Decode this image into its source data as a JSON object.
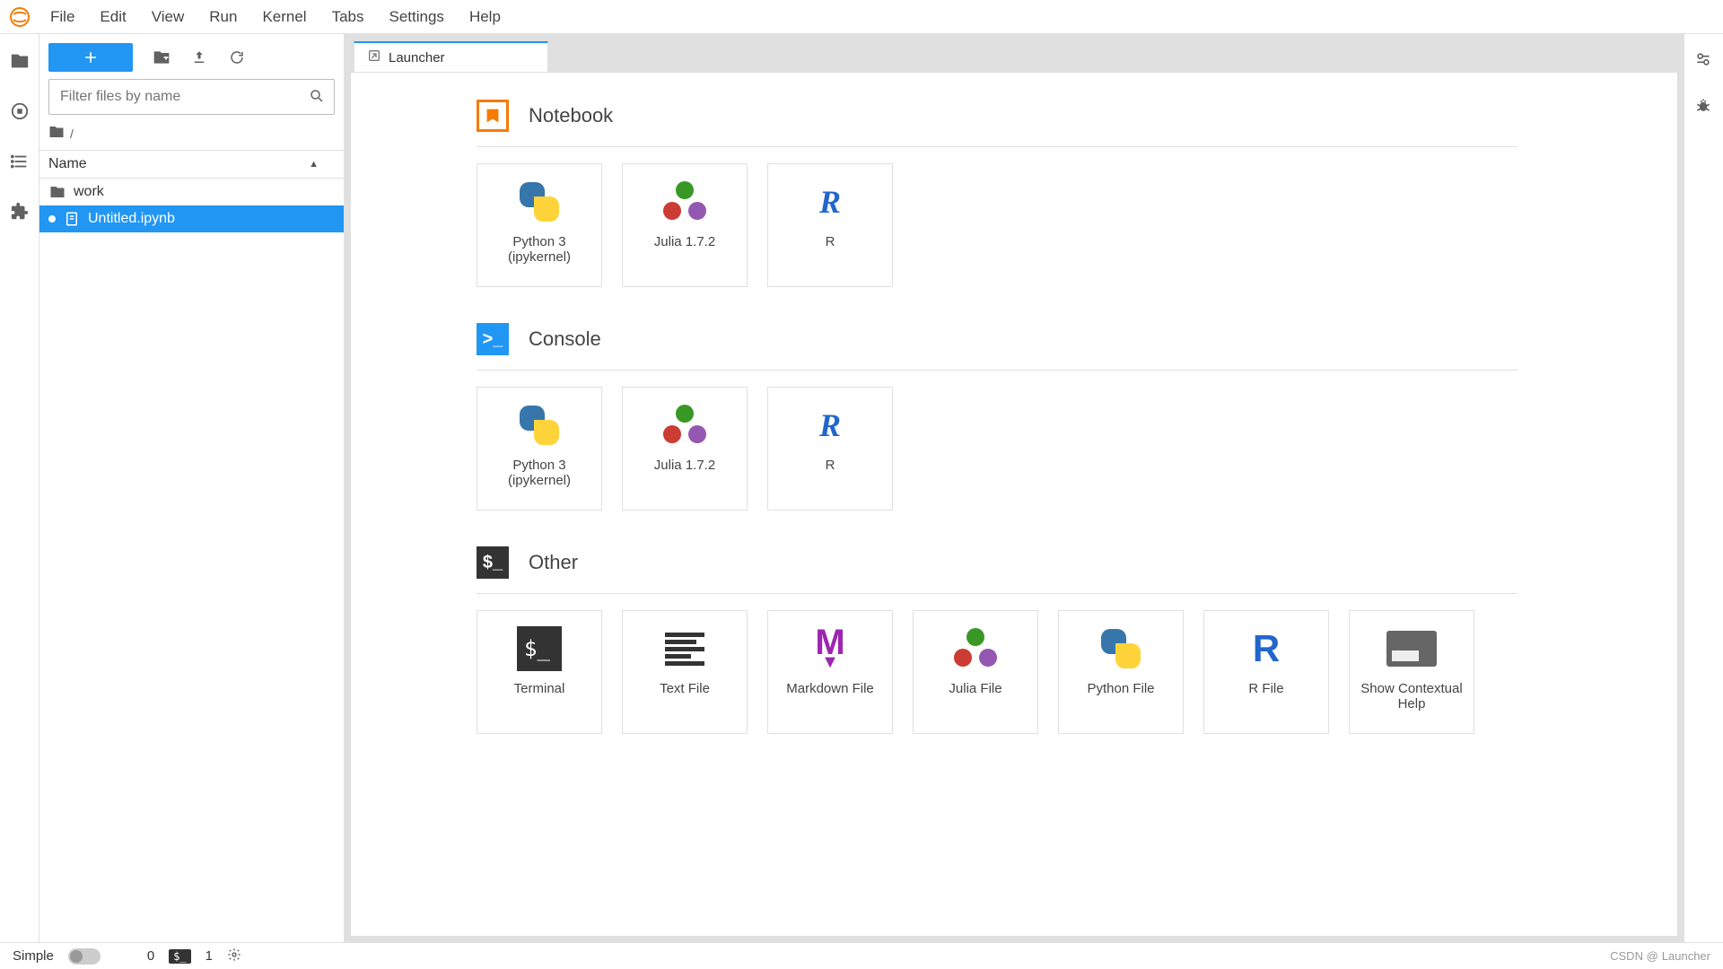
{
  "menu": {
    "items": [
      "File",
      "Edit",
      "View",
      "Run",
      "Kernel",
      "Tabs",
      "Settings",
      "Help"
    ]
  },
  "file_browser": {
    "filter_placeholder": "Filter files by name",
    "header_name": "Name",
    "path_sep": "/",
    "files": [
      {
        "name": "work",
        "type": "folder",
        "selected": false,
        "running": false
      },
      {
        "name": "Untitled.ipynb",
        "type": "notebook",
        "selected": true,
        "running": true
      }
    ]
  },
  "tab": {
    "title": "Launcher"
  },
  "launcher": {
    "sections": [
      {
        "title": "Notebook",
        "kind": "notebook",
        "cards": [
          {
            "label": "Python 3 (ipykernel)",
            "icon": "python"
          },
          {
            "label": "Julia 1.7.2",
            "icon": "julia"
          },
          {
            "label": "R",
            "icon": "r"
          }
        ]
      },
      {
        "title": "Console",
        "kind": "console",
        "cards": [
          {
            "label": "Python 3 (ipykernel)",
            "icon": "python"
          },
          {
            "label": "Julia 1.7.2",
            "icon": "julia"
          },
          {
            "label": "R",
            "icon": "r"
          }
        ]
      },
      {
        "title": "Other",
        "kind": "other",
        "cards": [
          {
            "label": "Terminal",
            "icon": "terminal"
          },
          {
            "label": "Text File",
            "icon": "text"
          },
          {
            "label": "Markdown File",
            "icon": "markdown"
          },
          {
            "label": "Julia File",
            "icon": "julia"
          },
          {
            "label": "Python File",
            "icon": "python"
          },
          {
            "label": "R File",
            "icon": "rfile"
          },
          {
            "label": "Show Contextual Help",
            "icon": "help"
          }
        ]
      }
    ]
  },
  "status": {
    "simple": "Simple",
    "kernels": "0",
    "terminals": "1",
    "credit": "CSDN @",
    "hint": "Launcher"
  }
}
